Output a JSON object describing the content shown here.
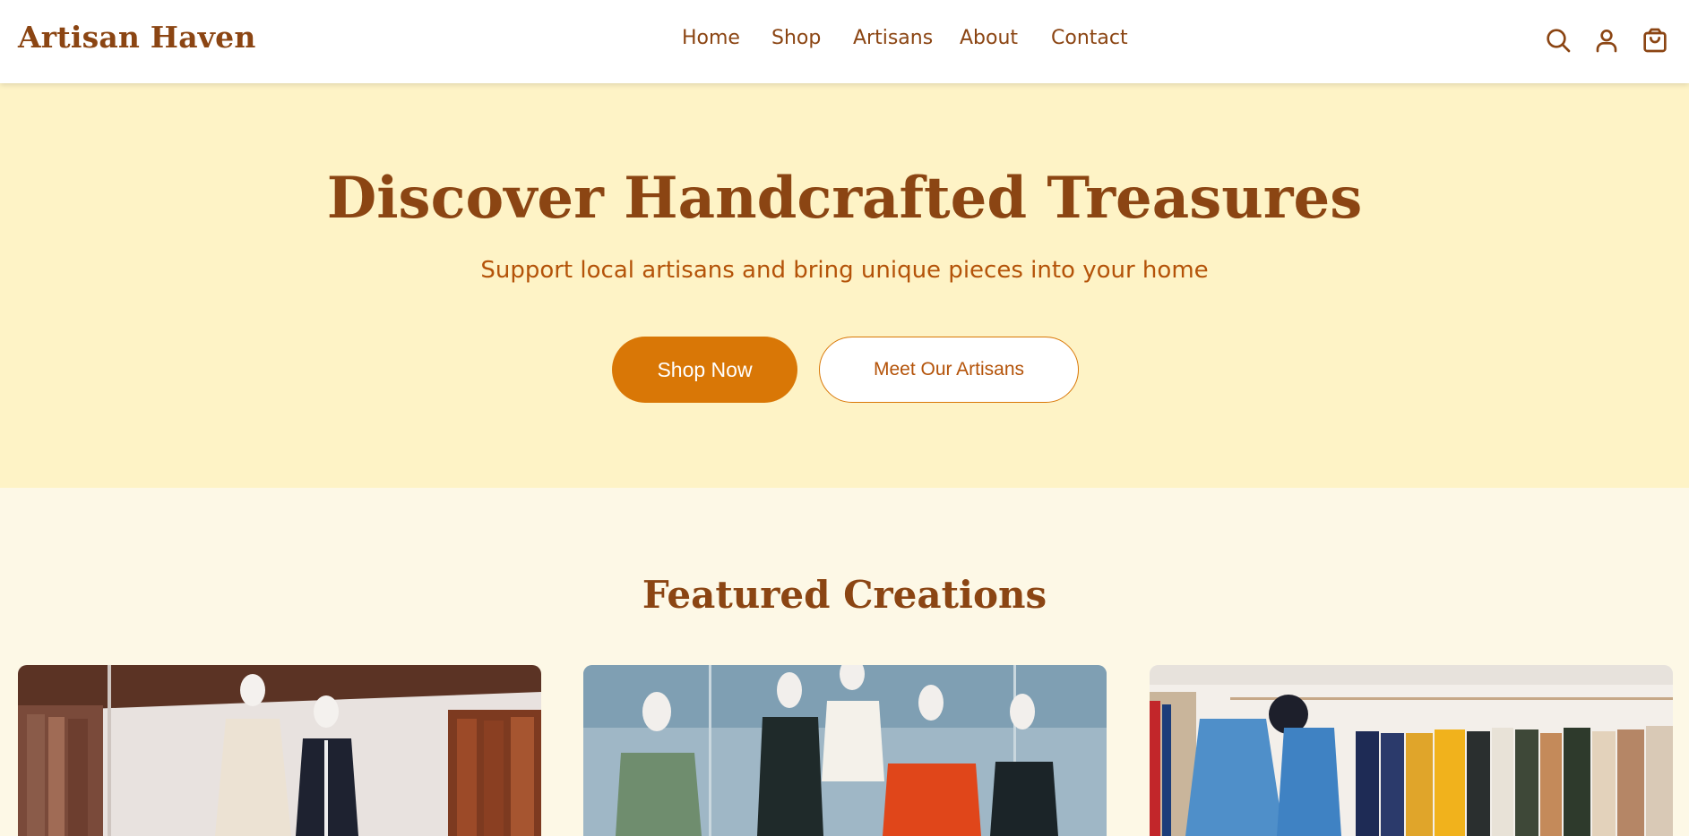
{
  "header": {
    "logo": "Artisan Haven",
    "nav": [
      "Home",
      "Shop",
      "Artisans",
      "About",
      "Contact"
    ],
    "icons": [
      "search-icon",
      "user-icon",
      "shopping-bag-icon"
    ]
  },
  "hero": {
    "title": "Discover Handcrafted Treasures",
    "subtitle": "Support local artisans and bring unique pieces into your home",
    "primary_button": "Shop Now",
    "secondary_button": "Meet Our Artisans"
  },
  "featured": {
    "title": "Featured Creations",
    "cards": [
      {
        "image": "store-mannequins-coats-photo"
      },
      {
        "image": "window-mannequins-dresses-photo"
      },
      {
        "image": "clothing-rack-coats-photo"
      }
    ]
  },
  "colors": {
    "brand": "#8b4513",
    "accent": "#d97706",
    "hero_bg": "#fef3c6",
    "page_bg": "#fdf8e6"
  }
}
